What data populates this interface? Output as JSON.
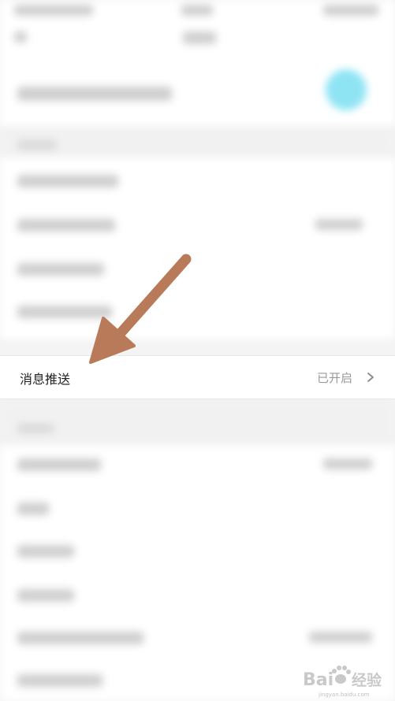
{
  "focus_row": {
    "label": "消息推送",
    "status": "已开启",
    "chevron_icon": "chevron-right-icon"
  },
  "annotation": {
    "arrow_color": "#b87a58",
    "arrow_icon": "pointer-arrow-icon"
  },
  "watermark": {
    "brand": "Bai",
    "brand_tail": "经验",
    "domain": "jingyan.baidu.com"
  },
  "colors": {
    "background": "#f4f4f4",
    "row_background": "#ffffff",
    "label_text": "#222222",
    "status_text": "#9a9a9a"
  }
}
